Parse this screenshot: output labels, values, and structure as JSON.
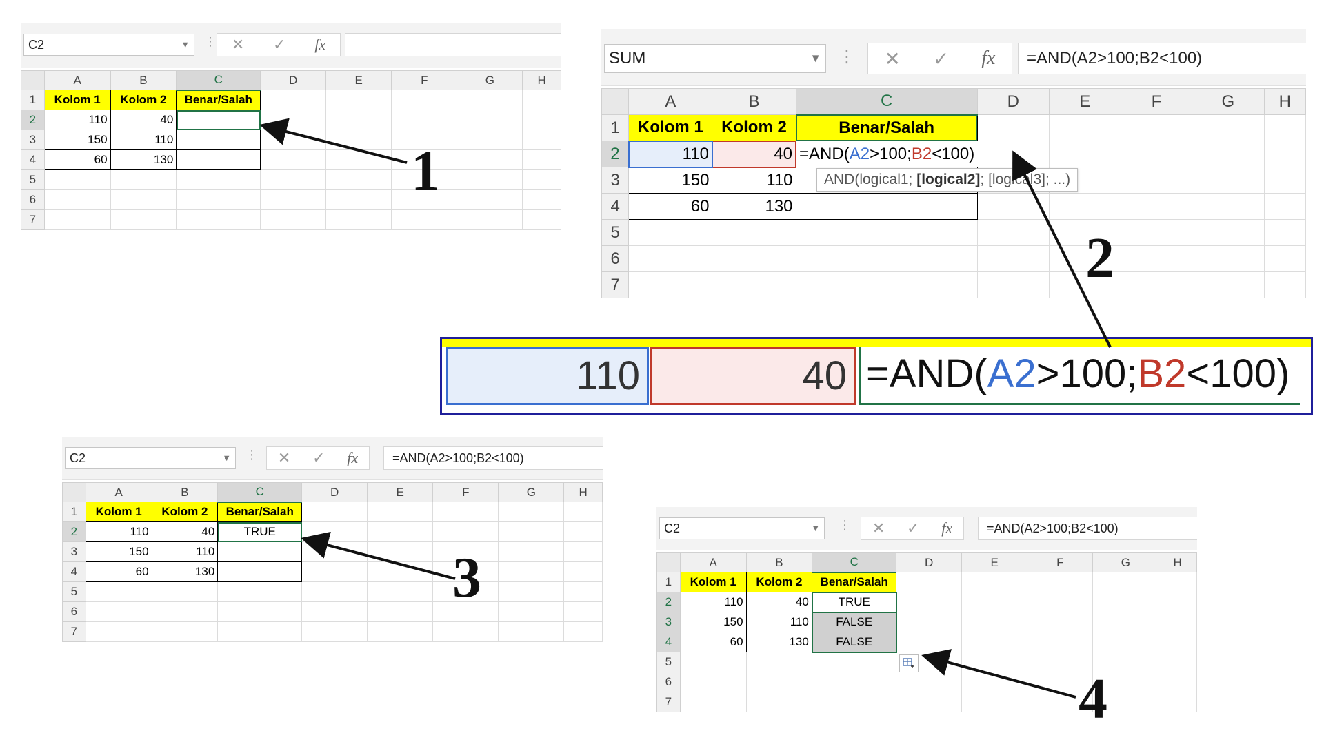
{
  "columns": [
    "A",
    "B",
    "C",
    "D",
    "E",
    "F",
    "G",
    "H"
  ],
  "rows": [
    "1",
    "2",
    "3",
    "4",
    "5",
    "6",
    "7"
  ],
  "header_cells": [
    "Kolom 1",
    "Kolom 2",
    "Benar/Salah"
  ],
  "data_rows": [
    [
      "110",
      "40"
    ],
    [
      "150",
      "110"
    ],
    [
      "60",
      "130"
    ]
  ],
  "formula": "=AND(A2>100;B2<100)",
  "formula_parts": [
    "=AND(",
    "A2",
    ">100;",
    "B2",
    "<100)"
  ],
  "tooltip": {
    "fn": "AND(logical1; ",
    "bold": "[logical2]",
    "rest": "; [logical3]; ...)"
  },
  "panel1": {
    "namebox": "C2",
    "formula_text": "",
    "results": [
      "",
      "",
      ""
    ]
  },
  "panel2": {
    "namebox": "SUM",
    "formula_text": "=AND(A2>100;B2<100)"
  },
  "panel3": {
    "namebox": "C2",
    "formula_text": "=AND(A2>100;B2<100)",
    "results": [
      "TRUE",
      "",
      ""
    ]
  },
  "panel4": {
    "namebox": "C2",
    "formula_text": "=AND(A2>100;B2<100)",
    "results": [
      "TRUE",
      "FALSE",
      "FALSE"
    ]
  },
  "zoom": {
    "a2": "110",
    "b2": "40"
  },
  "callouts": [
    "1",
    "2",
    "3",
    "4"
  ],
  "icons": {
    "cancel": "close-icon",
    "enter": "check-icon",
    "function": "fx-icon",
    "autofill": "autofill-options-icon"
  },
  "colors": {
    "header_fill": "#ffff00",
    "excel_green": "#217346",
    "ref_blue": "#3a6fd0",
    "ref_red": "#c0392b",
    "zoom_frame": "#1f1f9a"
  }
}
